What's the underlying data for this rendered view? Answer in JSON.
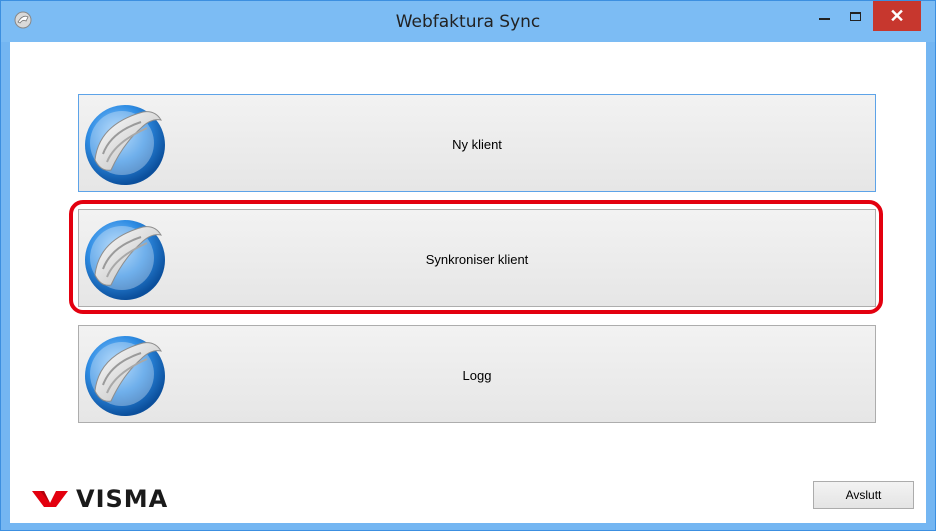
{
  "window": {
    "title": "Webfaktura Sync",
    "close_glyph": "✕",
    "titlebar_color": "#7cbcf4",
    "close_color": "#c7372e"
  },
  "buttons": [
    {
      "label": "Ny klient",
      "icon": "sync-cloud-icon"
    },
    {
      "label": "Synkroniser klient",
      "icon": "sync-cloud-icon"
    },
    {
      "label": "Logg",
      "icon": "sync-cloud-icon"
    }
  ],
  "footer": {
    "logo_text": "VISMA",
    "logo_color": "#e3000f",
    "exit_label": "Avslutt"
  },
  "highlight_color": "#e3000f"
}
